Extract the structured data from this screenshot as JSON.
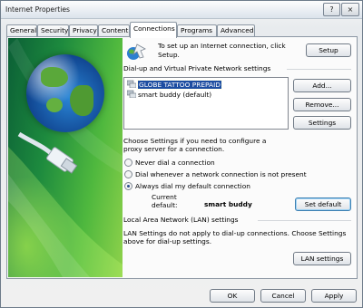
{
  "window": {
    "title": "Internet Properties",
    "help_glyph": "?",
    "close_glyph": "×"
  },
  "tabs": [
    {
      "label": "General"
    },
    {
      "label": "Security"
    },
    {
      "label": "Privacy"
    },
    {
      "label": "Content"
    },
    {
      "label": "Connections",
      "active": true
    },
    {
      "label": "Programs"
    },
    {
      "label": "Advanced"
    }
  ],
  "setup": {
    "text_line1": "To set up an Internet connection, click",
    "text_line2": "Setup.",
    "button": "Setup"
  },
  "dialup": {
    "heading": "Dial-up and Virtual Private Network settings",
    "connections": [
      {
        "name": "GLOBE TATTOO PREPAID",
        "selected": true
      },
      {
        "name": "smart buddy (default)",
        "selected": false
      }
    ],
    "add_button": "Add...",
    "remove_button": "Remove...",
    "settings_button": "Settings"
  },
  "proxy": {
    "text_line1": "Choose Settings if you need to configure a",
    "text_line2": "proxy server for a connection."
  },
  "dial_options": [
    {
      "label": "Never dial a connection",
      "selected": false
    },
    {
      "label": "Dial whenever a network connection is not present",
      "selected": false
    },
    {
      "label": "Always dial my default connection",
      "selected": true
    }
  ],
  "current_default": {
    "label_line1": "Current",
    "label_line2": "default:",
    "value": "smart buddy",
    "button": "Set default"
  },
  "lan": {
    "heading": "Local Area Network (LAN) settings",
    "text_line1": "LAN Settings do not apply to dial-up connections. Choose Settings",
    "text_line2": "above for dial-up settings.",
    "button": "LAN settings"
  },
  "footer": {
    "ok": "OK",
    "cancel": "Cancel",
    "apply": "Apply"
  }
}
